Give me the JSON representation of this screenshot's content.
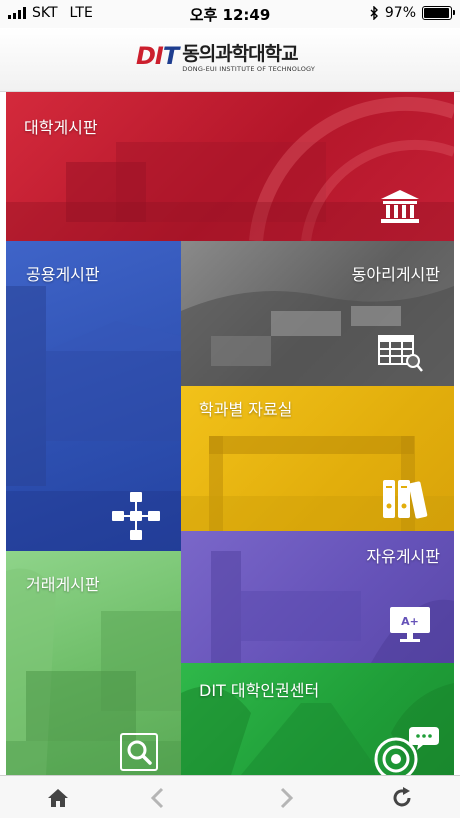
{
  "status_bar": {
    "carrier": "SKT",
    "network": "LTE",
    "time": "오후 12:49",
    "battery": "97%",
    "battery_level": 0.97
  },
  "header": {
    "logo_mark": "DIT",
    "logo_name": "동의과학대학교",
    "logo_subtitle": "DONG-EUI INSTITUTE OF TECHNOLOGY"
  },
  "tiles": [
    {
      "label": "대학게시판",
      "icon": "building-icon",
      "color": "#c41f33"
    },
    {
      "label": "공용게시판",
      "icon": "network-icon",
      "color": "#2f52b3"
    },
    {
      "label": "동아리게시판",
      "icon": "table-search-icon",
      "color": "#6b6b6b"
    },
    {
      "label": "학과별 자료실",
      "icon": "binders-icon",
      "color": "#e4b010"
    },
    {
      "label": "거래게시판",
      "icon": "search-icon",
      "color": "#6fbf69"
    },
    {
      "label": "자유게시판",
      "icon": "monitor-icon",
      "color": "#6653b9"
    },
    {
      "label": "DIT 대학인권센터",
      "icon": "target-chat-icon",
      "color": "#23a53c"
    }
  ],
  "toolbar": {
    "home": "home-icon",
    "back": "back-icon",
    "forward": "forward-icon",
    "refresh": "refresh-icon"
  }
}
